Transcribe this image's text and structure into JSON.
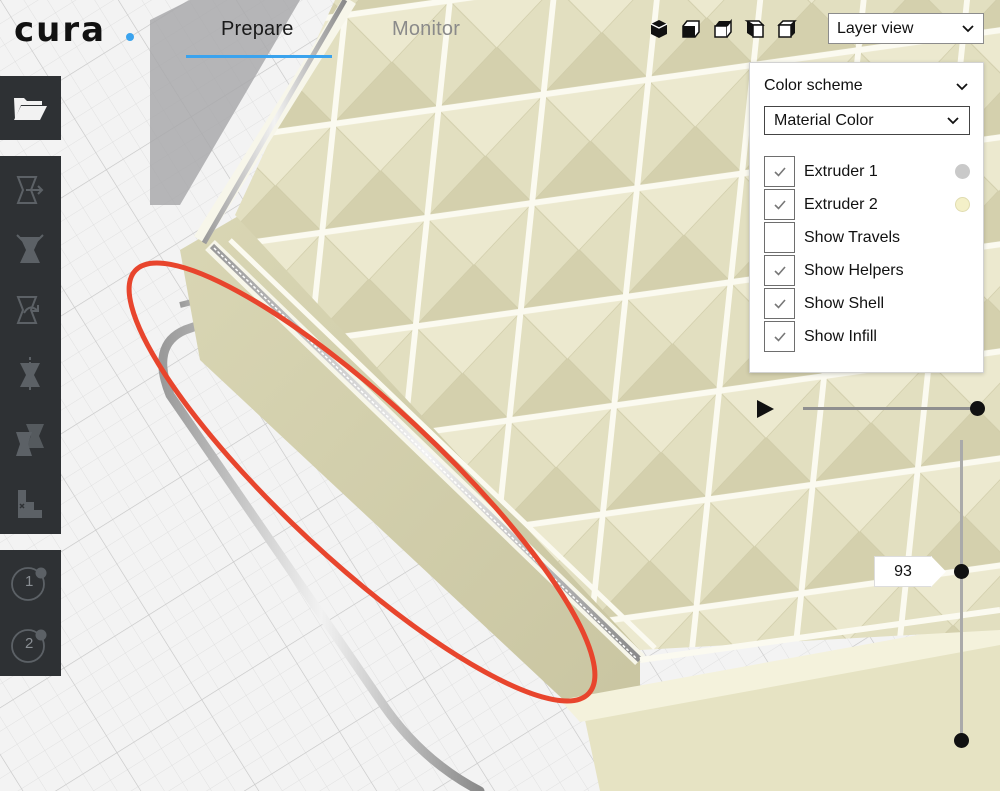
{
  "app": {
    "logo_text": "cura",
    "accent": "#3aa3ee"
  },
  "tabs": [
    {
      "label": "Prepare",
      "active": true
    },
    {
      "label": "Monitor",
      "active": false
    }
  ],
  "camera_views": [
    "3d-view-icon",
    "front-view-icon",
    "top-view-icon",
    "left-view-icon",
    "right-view-icon"
  ],
  "view_mode": {
    "selected": "Layer view"
  },
  "layer_panel": {
    "title": "Color scheme",
    "scheme": "Material Color",
    "options": [
      {
        "label": "Extruder 1",
        "checked": true,
        "swatch": "#c9c9c9"
      },
      {
        "label": "Extruder 2",
        "checked": true,
        "swatch": "#f4f0c8"
      },
      {
        "label": "Show Travels",
        "checked": false
      },
      {
        "label": "Show Helpers",
        "checked": true
      },
      {
        "label": "Show Shell",
        "checked": true
      },
      {
        "label": "Show Infill",
        "checked": true
      }
    ]
  },
  "layer_slider": {
    "current_layer": "93"
  },
  "toolbar": {
    "open_icon": "folder-open-icon",
    "tools": [
      "move-tool-icon",
      "scale-tool-icon",
      "rotate-tool-icon",
      "mirror-tool-icon",
      "per-model-settings-icon",
      "support-blocker-icon"
    ],
    "extruders": [
      {
        "label": "1"
      },
      {
        "label": "2"
      }
    ]
  },
  "colors": {
    "material": "#e9e6c8",
    "annotation": "#e8452d",
    "toolbar": "#2e3134"
  }
}
